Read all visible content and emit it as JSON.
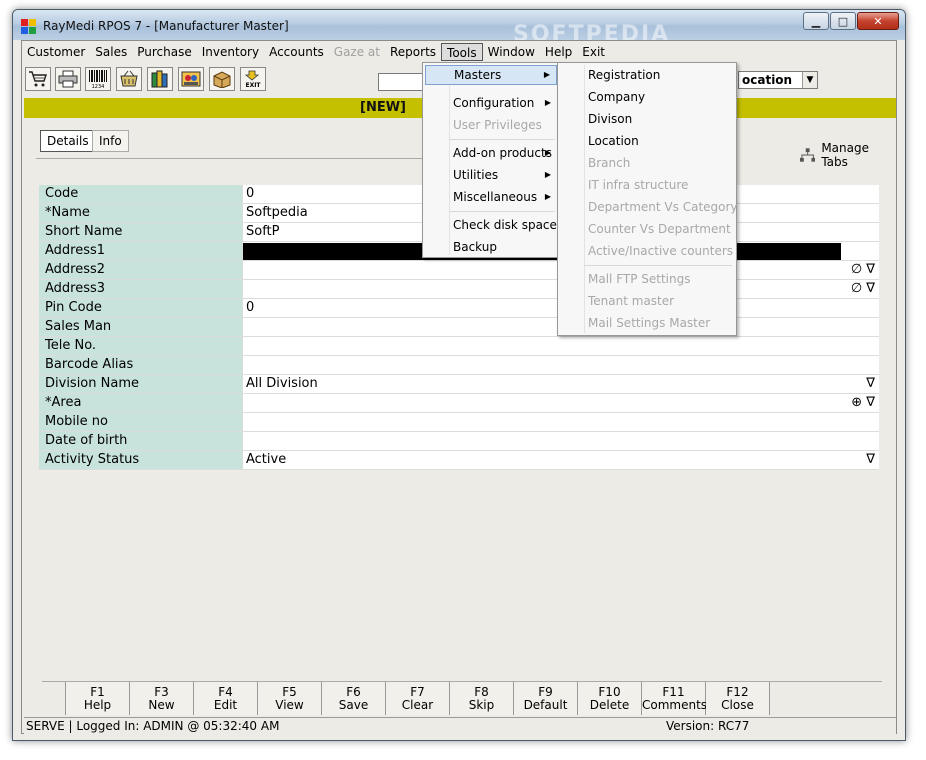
{
  "window": {
    "title": "RayMedi RPOS 7 - [Manufacturer Master]",
    "minimize_glyph": "▁",
    "maximize_glyph": "□",
    "close_glyph": "✕"
  },
  "watermark": "SOFTPEDIA",
  "menubar": [
    "Customer",
    "Sales",
    "Purchase",
    "Inventory",
    "Accounts",
    "Gaze at",
    "Reports",
    "Tools",
    "Window",
    "Help",
    "Exit"
  ],
  "toolbar": {
    "buttons": [
      "cart-icon",
      "printer-icon",
      "barcode-icon",
      "basket-icon",
      "books-icon",
      "contacts-icon",
      "package-icon",
      "exit-icon"
    ],
    "barcode_text": "1234",
    "exit_text": "EXIT",
    "select_value": "ocation"
  },
  "record_status": "[NEW]",
  "tabs": [
    "Details",
    "Info"
  ],
  "manage_tabs": "Manage Tabs",
  "fields": [
    {
      "label": "Code",
      "value": "0"
    },
    {
      "label": "*Name",
      "value": "Softpedia"
    },
    {
      "label": "Short Name",
      "value": "SoftP"
    },
    {
      "label": "Address1",
      "value": ""
    },
    {
      "label": "Address2",
      "value": ""
    },
    {
      "label": "Address3",
      "value": ""
    },
    {
      "label": "Pin Code",
      "value": "0"
    },
    {
      "label": "Sales Man",
      "value": ""
    },
    {
      "label": "Tele No.",
      "value": ""
    },
    {
      "label": "Barcode Alias",
      "value": ""
    },
    {
      "label": "Division Name",
      "value": "All Division"
    },
    {
      "label": "*Area",
      "value": ""
    },
    {
      "label": "Mobile no",
      "value": ""
    },
    {
      "label": "Date of birth",
      "value": ""
    },
    {
      "label": "Activity Status",
      "value": "Active"
    }
  ],
  "field_icons": {
    "clear": "∅",
    "dropdown": "∇",
    "add": "⊕"
  },
  "fkeys": [
    {
      "key": "F1",
      "label": "Help"
    },
    {
      "key": "F3",
      "label": "New"
    },
    {
      "key": "F4",
      "label": "Edit"
    },
    {
      "key": "F5",
      "label": "View"
    },
    {
      "key": "F6",
      "label": "Save"
    },
    {
      "key": "F7",
      "label": "Clear"
    },
    {
      "key": "F8",
      "label": "Skip"
    },
    {
      "key": "F9",
      "label": "Default"
    },
    {
      "key": "F10",
      "label": "Delete"
    },
    {
      "key": "F11",
      "label": "Comments"
    },
    {
      "key": "F12",
      "label": "Close"
    }
  ],
  "statusbar": {
    "left": "SERVE |  Logged In: ADMIN  @ 05:32:40 AM",
    "right": "Version: RC77"
  },
  "tools_menu": {
    "items": [
      "Masters",
      "Configuration",
      "User Privileges",
      "Add-on products",
      "Utilities",
      "Miscellaneous",
      "Check disk space",
      "Backup"
    ],
    "submenu_arrow": "▶"
  },
  "masters_menu": {
    "items": [
      "Registration",
      "Company",
      "Divison",
      "Location",
      "Branch",
      "IT infra structure",
      "Department Vs Category",
      "Counter Vs Department",
      "Active/Inactive counters",
      "Mall FTP Settings",
      "Tenant master",
      "Mail Settings Master"
    ]
  },
  "colors": {
    "label_bg": "#c8e2dc",
    "status_strip": "#c4c000",
    "menu_selected": "#d6e6f5"
  }
}
